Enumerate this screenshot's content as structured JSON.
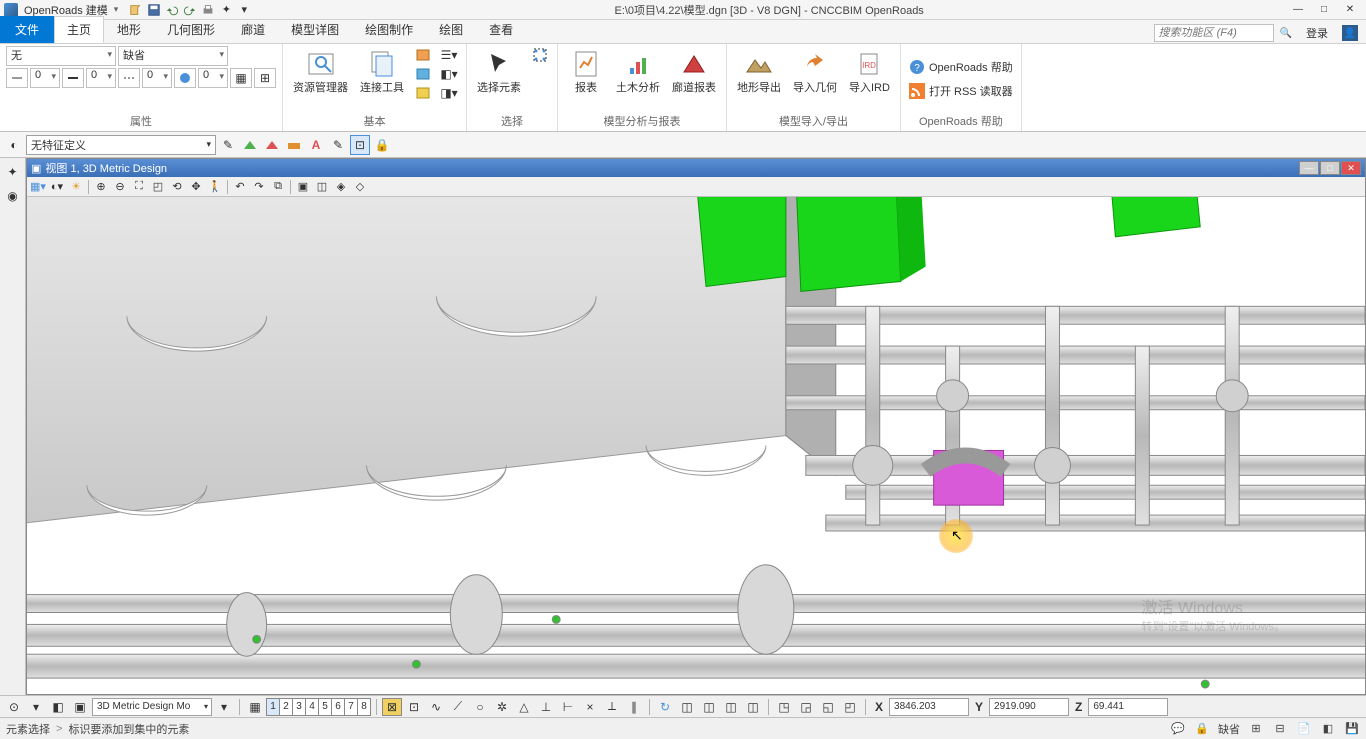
{
  "app": {
    "workflow": "OpenRoads 建模",
    "title_path": "E:\\0项目\\4.22\\模型.dgn [3D - V8 DGN] - CNCCBIM OpenRoads"
  },
  "ribbon_tabs": {
    "file": "文件",
    "items": [
      "主页",
      "地形",
      "几何图形",
      "廊道",
      "模型详图",
      "绘图制作",
      "绘图",
      "查看"
    ],
    "active_index": 0,
    "search_placeholder": "搜索功能区 (F4)",
    "login": "登录"
  },
  "ribbon": {
    "groups": {
      "attributes": {
        "label": "属性",
        "layer": "无",
        "level": "缺省",
        "num0": "0",
        "num1": "0",
        "num2": "0",
        "num3": "0"
      },
      "basic": {
        "label": "基本",
        "explorer": "资源管理器",
        "attach": "连接工具"
      },
      "select": {
        "label": "选择",
        "select_elem": "选择元素"
      },
      "analysis": {
        "label": "模型分析与报表",
        "report": "报表",
        "civil": "土木分析",
        "corridor_rpt": "廊道报表"
      },
      "model_io": {
        "label": "模型导入/导出",
        "terrain_export": "地形导出",
        "import_geom": "导入几何",
        "import_ird": "导入IRD"
      },
      "help": {
        "label": "OpenRoads 帮助",
        "help_link": "OpenRoads 帮助",
        "rss_link": "打开 RSS 读取器"
      }
    }
  },
  "toolbar2": {
    "feature_def": "无特征定义"
  },
  "view": {
    "title": "视图 1, 3D Metric Design"
  },
  "bottombar": {
    "model": "3D Metric Design Mo",
    "view_numbers": [
      "1",
      "2",
      "3",
      "4",
      "5",
      "6",
      "7",
      "8"
    ],
    "active_view": 0,
    "coords": {
      "x_label": "X",
      "x": "3846.203",
      "y_label": "Y",
      "y": "2919.090",
      "z_label": "Z",
      "z": "69.441"
    }
  },
  "status": {
    "left1": "元素选择",
    "left2": "标识要添加到集中的元素",
    "snap": "缺省"
  },
  "watermark": {
    "line1": "激活 Windows",
    "line2": "转到\"设置\"以激活 Windows。"
  }
}
